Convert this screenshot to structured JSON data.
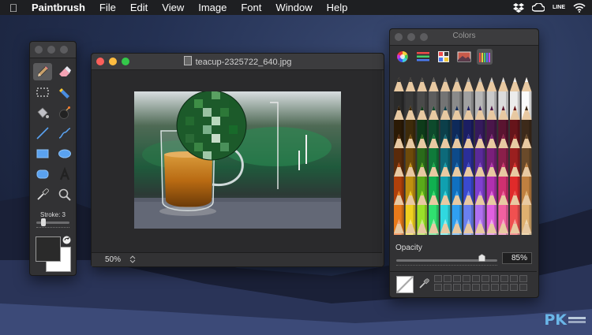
{
  "menubar": {
    "app_name": "Paintbrush",
    "items": [
      "File",
      "Edit",
      "View",
      "Image",
      "Font",
      "Window",
      "Help"
    ],
    "status_badge": "LINE"
  },
  "tools_window": {
    "stroke_label": "Stroke: 3",
    "stroke_value": 3,
    "tools": [
      {
        "name": "pencil-icon",
        "selected": true
      },
      {
        "name": "eraser-icon"
      },
      {
        "name": "selection-icon"
      },
      {
        "name": "spray-icon"
      },
      {
        "name": "bucket-icon"
      },
      {
        "name": "bomb-icon"
      },
      {
        "name": "line-icon"
      },
      {
        "name": "curve-icon"
      },
      {
        "name": "rectangle-icon"
      },
      {
        "name": "ellipse-icon"
      },
      {
        "name": "rounded-rect-icon"
      },
      {
        "name": "text-icon"
      },
      {
        "name": "eyedropper-icon"
      },
      {
        "name": "zoom-icon"
      }
    ],
    "foreground_color": "#2a2a2a",
    "background_color": "#ffffff"
  },
  "image_window": {
    "title": "teacup-2325722_640.jpg",
    "zoom": "50%"
  },
  "colors_panel": {
    "title": "Colors",
    "tabs": [
      "color-wheel-icon",
      "sliders-icon",
      "palettes-icon",
      "image-palette-icon",
      "pencils-icon"
    ],
    "selected_tab": 4,
    "opacity_label": "Opacity",
    "opacity_value": "85%",
    "opacity_fraction": 0.85,
    "pencil_rows": [
      [
        "#2b2b2b",
        "#3a3a3a",
        "#4a4a4a",
        "#5e5e5e",
        "#747474",
        "#8a8a8a",
        "#a0a0a0",
        "#b6b6b6",
        "#cacaca",
        "#dcdcdc",
        "#ececec",
        "#fbfbfb"
      ],
      [
        "#2b1a05",
        "#3e2b0a",
        "#0e3b1a",
        "#0d4a2c",
        "#0c3f4a",
        "#0e2a5a",
        "#1b1e63",
        "#351a5c",
        "#4a164a",
        "#5a1430",
        "#66141a",
        "#3d2a1a"
      ],
      [
        "#5a2a0a",
        "#6e4a0a",
        "#2a6a1a",
        "#0f7a3a",
        "#0d6a7a",
        "#0d4a8a",
        "#2a2e99",
        "#5a2a99",
        "#7a1f7a",
        "#8a1f4a",
        "#9a1f1f",
        "#6a4a2a"
      ],
      [
        "#b0400a",
        "#c09010",
        "#5aaa1a",
        "#10b050",
        "#10a0b0",
        "#1070c0",
        "#3a4ad0",
        "#8040d0",
        "#b030b0",
        "#d03070",
        "#e02a2a",
        "#c08040"
      ],
      [
        "#e87a1a",
        "#f0d020",
        "#9ae02a",
        "#30e070",
        "#30d8e0",
        "#30a0f0",
        "#6a80f0",
        "#b070f0",
        "#e060e0",
        "#f060a0",
        "#f05050",
        "#e0b070"
      ],
      [
        "#f8a06a",
        "#fae880",
        "#c8f080",
        "#90f0b0",
        "#90f0f0",
        "#90c8f8",
        "#a8b8f8",
        "#d0a8f8",
        "#f0a8f0",
        "#f8a8c8",
        "#f89898",
        "#f0d8b0"
      ]
    ]
  }
}
